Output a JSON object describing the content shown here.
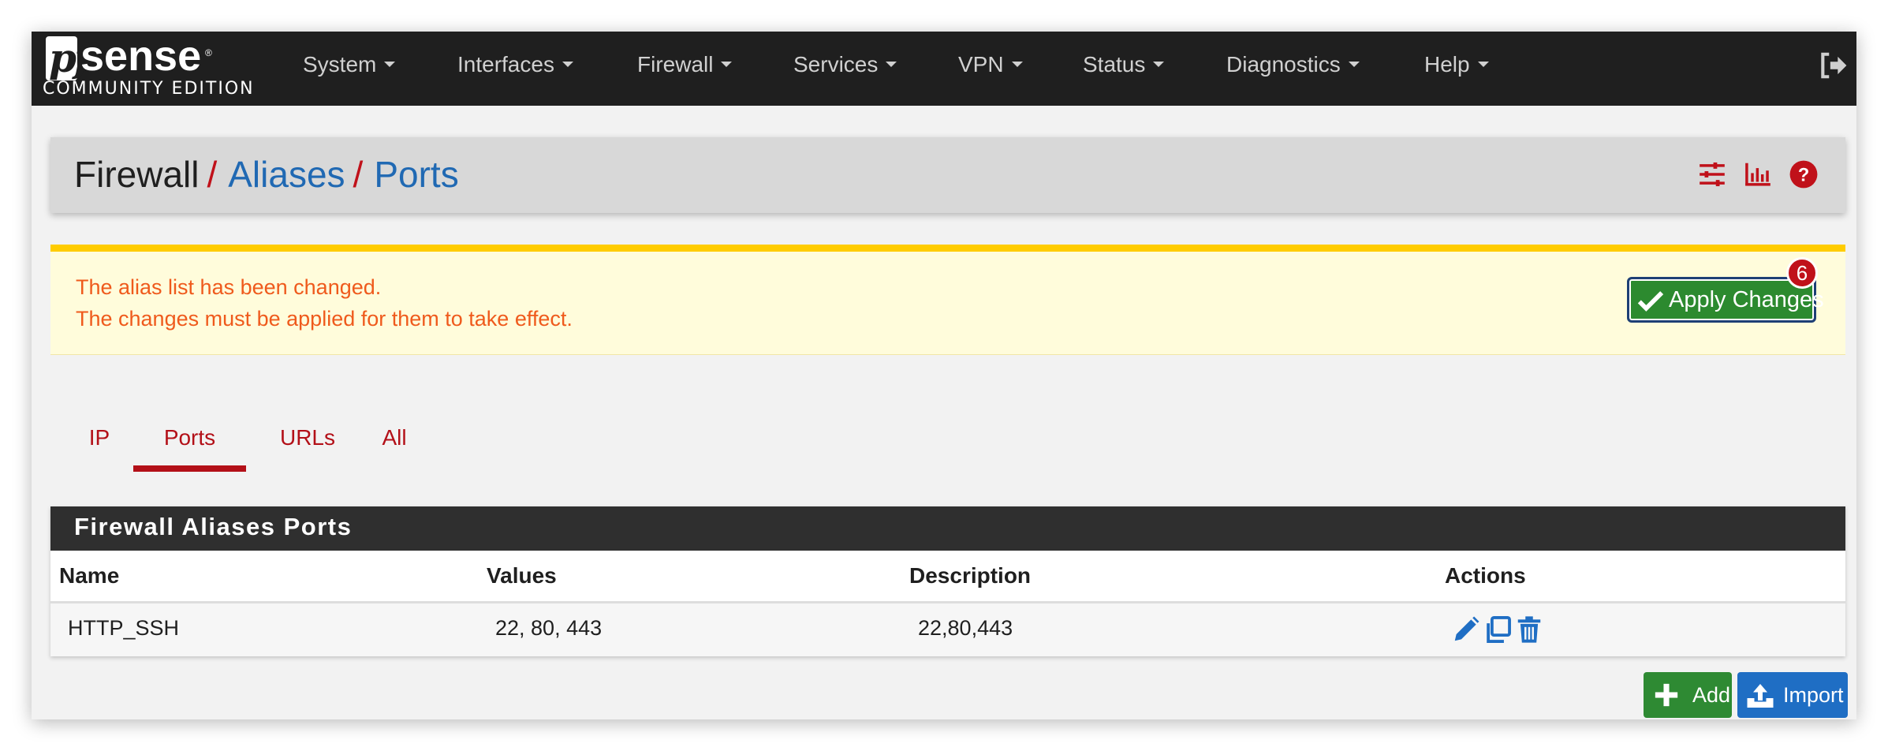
{
  "brand": {
    "name_prefix": "pf",
    "name_main": "sense",
    "registered": "®",
    "edition": "COMMUNITY EDITION"
  },
  "nav": {
    "items": [
      {
        "label": "System"
      },
      {
        "label": "Interfaces"
      },
      {
        "label": "Firewall"
      },
      {
        "label": "Services"
      },
      {
        "label": "VPN"
      },
      {
        "label": "Status"
      },
      {
        "label": "Diagnostics"
      },
      {
        "label": "Help"
      }
    ],
    "logout_icon": "logout-icon"
  },
  "breadcrumb": {
    "section": "Firewall",
    "separator": "/",
    "page": "Aliases",
    "subpage": "Ports",
    "icons": [
      "sliders-icon",
      "bar-chart-icon",
      "help-icon"
    ]
  },
  "alert": {
    "line1": "The alias list has been changed.",
    "line2": "The changes must be applied for them to take effect.",
    "apply_label": "Apply Changes",
    "badge_count": "6"
  },
  "tabs": {
    "items": [
      {
        "label": "IP"
      },
      {
        "label": "Ports"
      },
      {
        "label": "URLs"
      },
      {
        "label": "All"
      }
    ],
    "active": "Ports"
  },
  "table": {
    "title": "Firewall Aliases Ports",
    "columns": [
      "Name",
      "Values",
      "Description",
      "Actions"
    ],
    "rows": [
      {
        "name": "HTTP_SSH",
        "values": "22, 80, 443",
        "description": "22,80,443",
        "actions": [
          "edit-icon",
          "copy-icon",
          "trash-icon"
        ]
      }
    ]
  },
  "buttons": {
    "add": "Add",
    "import": "Import"
  },
  "colors": {
    "navbar": "#1f1f1f",
    "link_blue": "#2069b3",
    "accent_red": "#b31018",
    "alert_text": "#ef5a1c",
    "alert_border": "#ffcc00",
    "success_green": "#2e8a33",
    "primary_blue": "#1f6ec4"
  }
}
